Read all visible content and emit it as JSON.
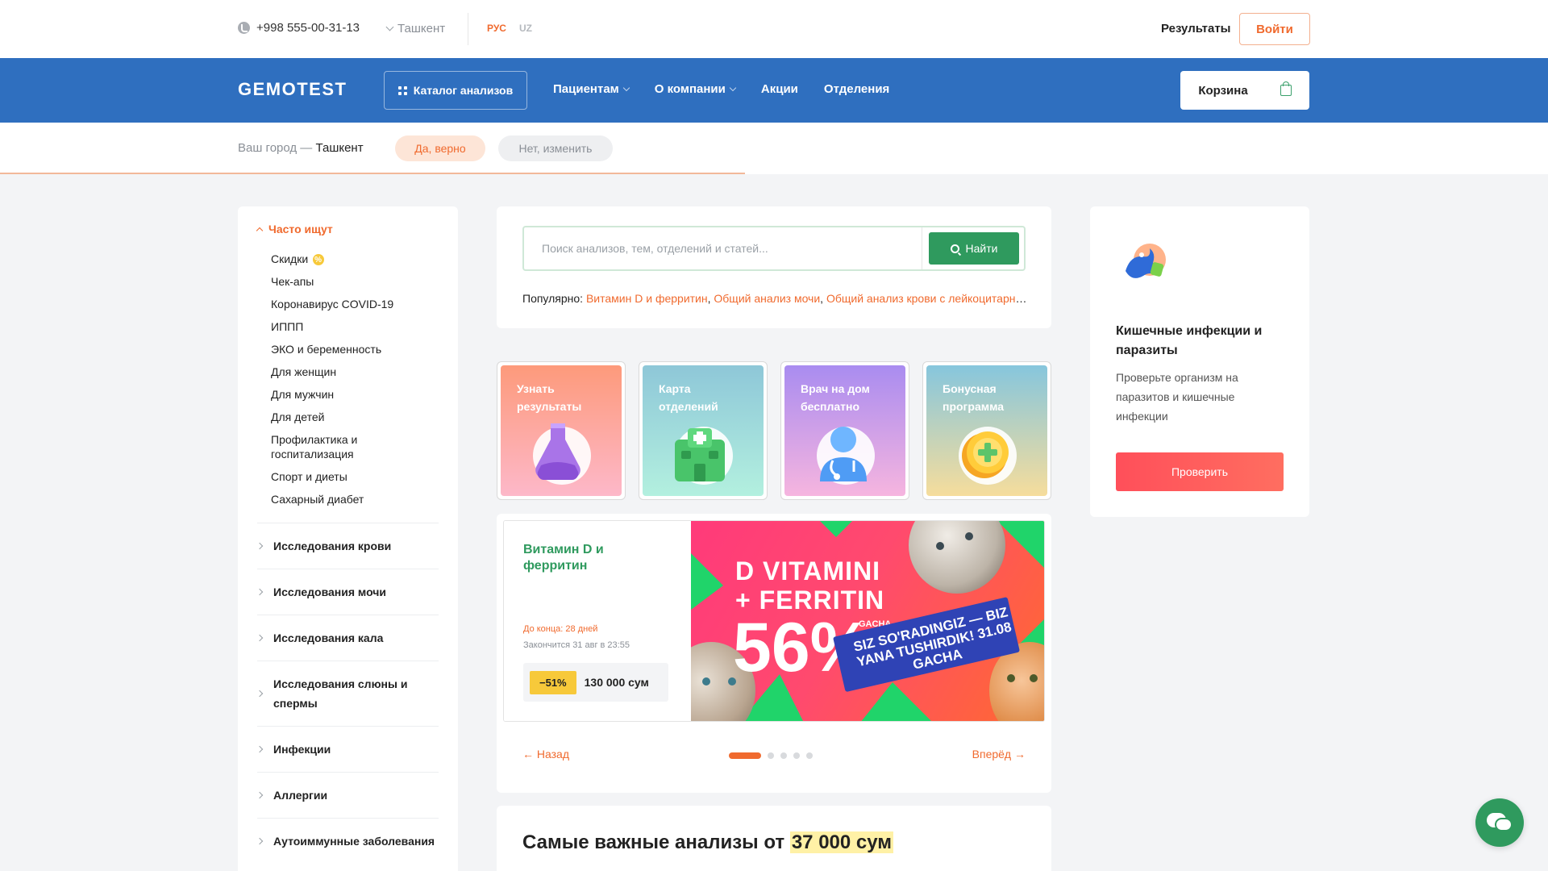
{
  "topbar": {
    "phone": "+998 555-00-31-13",
    "city": "Ташкент",
    "lang_ru": "РУС",
    "lang_uz": "UZ",
    "results": "Результаты",
    "login": "Войти"
  },
  "header": {
    "logo": "GEMOTEST",
    "catalog": "Каталог анализов",
    "nav": [
      "Пациентам",
      "О компании",
      "Акции",
      "Отделения"
    ],
    "cart": "Корзина"
  },
  "citybar": {
    "prefix": "Ваш город — ",
    "city": "Ташкент",
    "yes": "Да, верно",
    "no": "Нет, изменить"
  },
  "sidebar": {
    "heading": "Часто ищут",
    "items": [
      "Скидки",
      "Чек-апы",
      "Коронавирус COVID-19",
      "ИППП",
      "ЭКО и беременность",
      "Для женщин",
      "Для мужчин",
      "Для детей",
      "Профилактика и госпитализация",
      "Спорт и диеты",
      "Сахарный диабет"
    ],
    "sections": [
      "Исследования крови",
      "Исследования мочи",
      "Исследования кала",
      "Исследования слюны и спермы",
      "Инфекции",
      "Аллергии",
      "Аутоиммунные заболевания"
    ]
  },
  "search": {
    "placeholder": "Поиск анализов, тем, отделений и статей...",
    "button": "Найти",
    "popular_label": "Популярно: ",
    "popular": [
      "Витамин D и ферритин",
      "Общий анализ мочи",
      "Общий анализ крови с лейкоцитарной формулой"
    ]
  },
  "tiles": [
    {
      "label": "Узнать результаты"
    },
    {
      "label": "Карта отделений"
    },
    {
      "label": "Врач на дом бесплатно"
    },
    {
      "label": "Бонусная программа"
    }
  ],
  "promo": {
    "title": "Витамин D и ферритин",
    "until": "До конца: 28 дней",
    "ends": "Закончится 31 авг в 23:55",
    "discount": "−51%",
    "price": "130 000 сум",
    "banner_line1": "D VITAMINI",
    "banner_line2": "+ FERRITIN",
    "banner_pct": "56%",
    "banner_gacha": "GACHA",
    "banner_slogan": "SIZ SO'RADINGIZ — BIZ YANA TUSHIRDIK! 31.08 GACHA",
    "back": "Назад",
    "next": "Вперёд",
    "slides": 5,
    "active_slide": 1
  },
  "important": {
    "title": "Самые важные анализы от ",
    "price": "37 000 сум"
  },
  "right_card": {
    "title": "Кишечные инфекции и паразиты",
    "text": "Проверьте организм на паразитов и кишечные инфекции",
    "button": "Проверить"
  },
  "colors": {
    "brand_blue": "#2f6fbf",
    "accent_orange": "#f06a2e",
    "accent_green": "#2f9a5e"
  }
}
